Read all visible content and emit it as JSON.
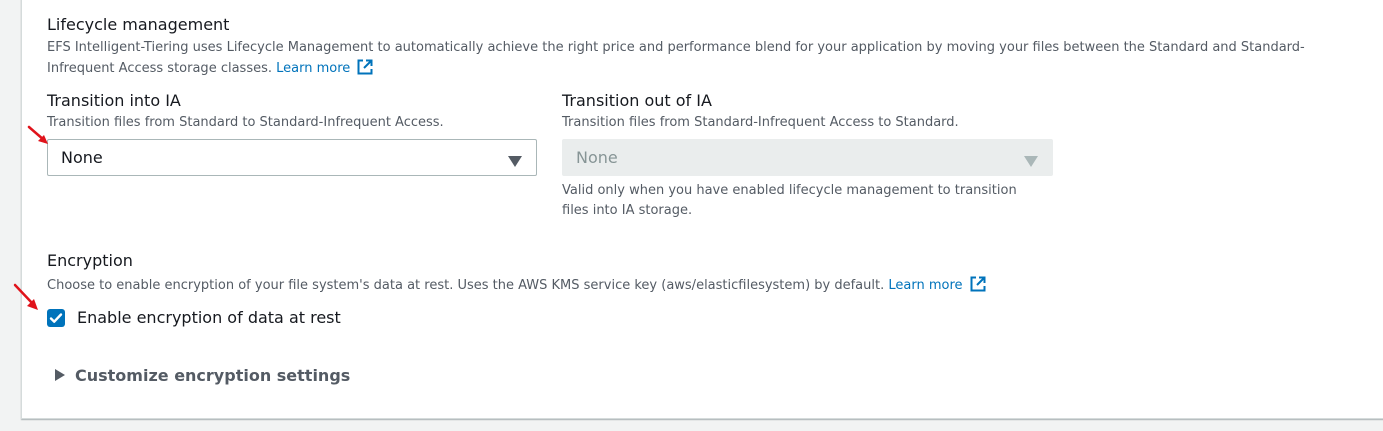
{
  "lifecycle": {
    "title": "Lifecycle management",
    "description_line1": "EFS Intelligent-Tiering uses Lifecycle Management to automatically achieve the right price and performance blend for your application by moving your files between the Standard and Standard-",
    "description_line2": "Infrequent Access storage classes.",
    "learn_more": "Learn more"
  },
  "transition_into_ia": {
    "label": "Transition into IA",
    "description": "Transition files from Standard to Standard-Infrequent Access.",
    "selected": "None"
  },
  "transition_out_of_ia": {
    "label": "Transition out of IA",
    "description": "Transition files from Standard-Infrequent Access to Standard.",
    "selected": "None",
    "disabled": true,
    "help_line1": "Valid only when you have enabled lifecycle management to transition",
    "help_line2": "files into IA storage."
  },
  "encryption": {
    "title": "Encryption",
    "description": "Choose to enable encryption of your file system's data at rest. Uses the AWS KMS service key (aws/elasticfilesystem) by default.",
    "learn_more": "Learn more",
    "checkbox_label": "Enable encryption of data at rest",
    "checked": true,
    "customize_label": "Customize encryption settings"
  },
  "icons": {
    "external_link": "external-link-icon",
    "dropdown": "caret-down-icon",
    "expand": "caret-right-icon",
    "check": "checkmark-icon",
    "annotation": "red-arrow-icon"
  },
  "colors": {
    "link": "#0073bb",
    "checkbox": "#0073bb",
    "annotation_arrow": "#e0131b",
    "disabled_bg": "#eaeded"
  }
}
